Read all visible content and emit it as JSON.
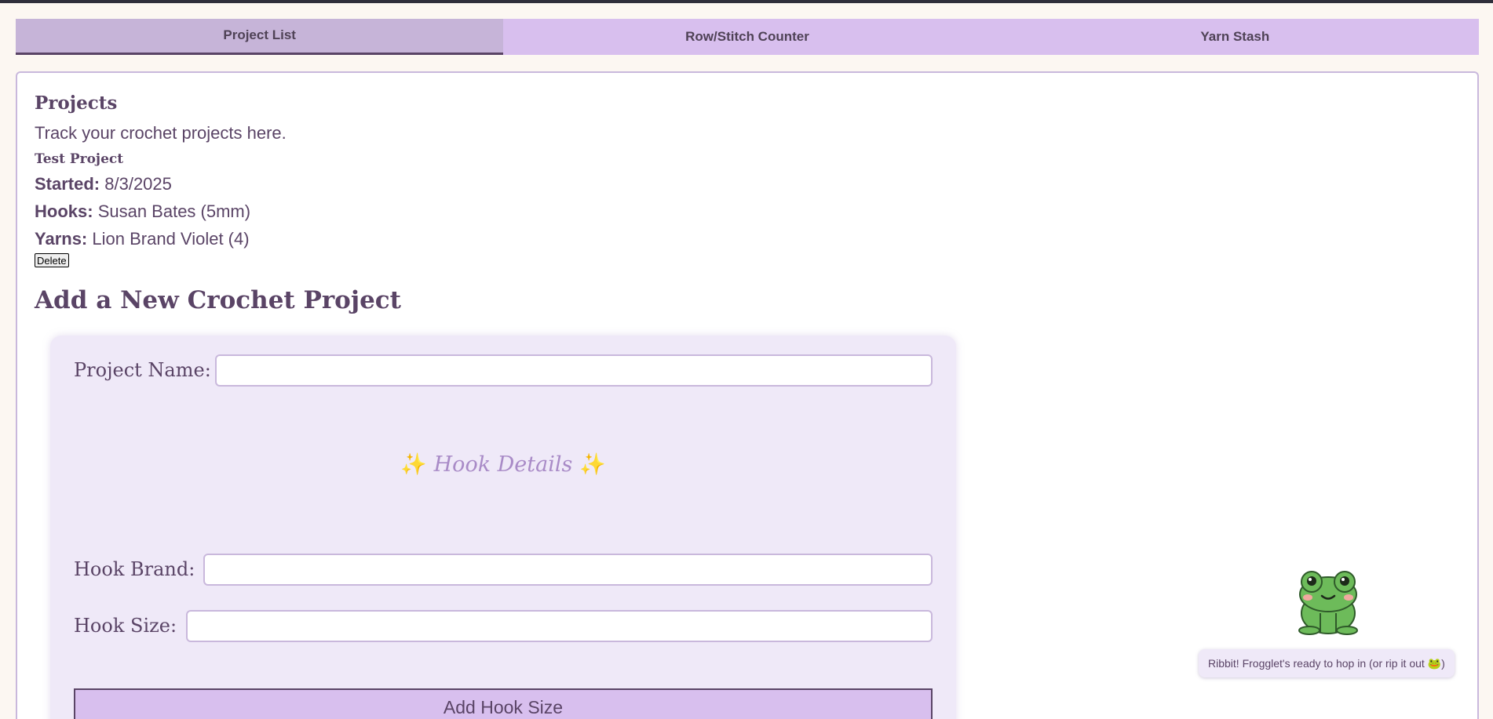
{
  "tabs": [
    {
      "label": "Project List",
      "active": true
    },
    {
      "label": "Row/Stitch Counter",
      "active": false
    },
    {
      "label": "Yarn Stash",
      "active": false
    }
  ],
  "projects": {
    "title": "Projects",
    "subtitle": "Track your crochet projects here.",
    "items": [
      {
        "name": "Test Project",
        "started_label": "Started:",
        "started_value": "8/3/2025",
        "hooks_label": "Hooks:",
        "hooks_value": "Susan Bates (5mm)",
        "yarns_label": "Yarns:",
        "yarns_value": "Lion Brand Violet (4)",
        "delete_label": "Delete"
      }
    ]
  },
  "form": {
    "title": "Add a New Crochet Project",
    "project_name_label": "Project Name:",
    "project_name_value": "",
    "hook_section_title": "Hook Details",
    "sparkle": "✨",
    "hook_brand_label": "Hook Brand:",
    "hook_brand_value": "",
    "hook_size_label": "Hook Size:",
    "hook_size_value": "",
    "add_hook_label": "Add Hook Size"
  },
  "mascot": {
    "icon": "frog-icon",
    "message": "Ribbit! Frogglet's ready to hop in (or rip it out 🐸)"
  },
  "colors": {
    "accent": "#d8bfee",
    "text": "#5a4466",
    "card": "#efe9f8",
    "background": "#fcf7f2"
  }
}
